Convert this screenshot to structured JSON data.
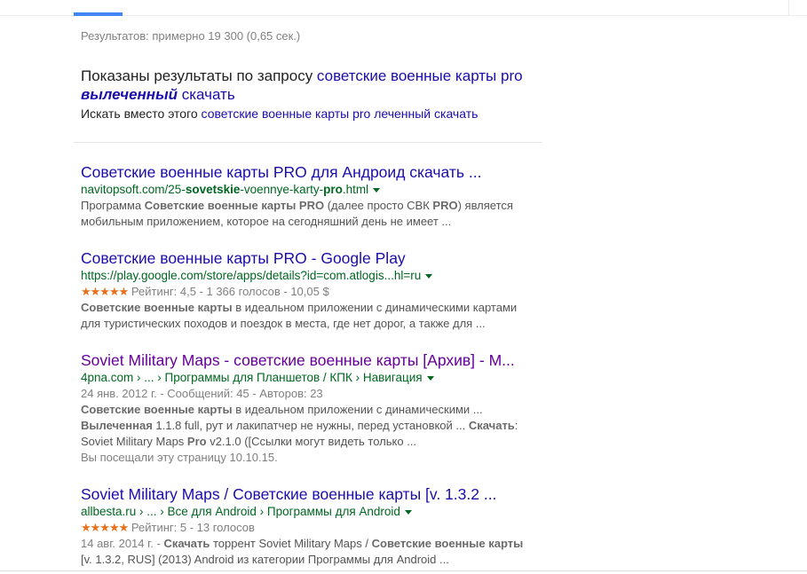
{
  "stats": "Результатов: примерно 19 300 (0,65 сек.)",
  "spelling": {
    "prefix": "Показаны результаты по запросу ",
    "corrected_part1": "советские военные карты",
    "corrected_part2": "pro",
    "corrected_word": "вылеченный",
    "corrected_part3": "скачать",
    "instead_prefix": "Искать вместо этого ",
    "instead_query": "советские военные карты pro леченный скачать"
  },
  "results": [
    {
      "title": "Советские военные карты PRO для Андроид скачать ...",
      "url_pre": "navitopsoft.com/25-",
      "url_b1": "sovetskie",
      "url_mid": "-voennye-karty-",
      "url_b2": "pro",
      "url_post": ".html",
      "snippet1_a": "Программа ",
      "snippet1_b": "Советские военные карты PRO",
      "snippet1_c": " (далее просто СВК ",
      "snippet1_d": "PRO",
      "snippet1_e": ") является",
      "snippet2": "мобильным приложением, которое на сегодняшний день не имеет ..."
    },
    {
      "title": "Советские военные карты PRO - Google Play",
      "url": "https://play.google.com/store/apps/details?id=com.atlogis...hl=ru",
      "stars": "★★★★★",
      "rating": "Рейтинг: 4,5 - 1 366 голосов - 10,05 $",
      "snippet1_b": "Советские военные карты",
      "snippet1_c": " в идеальном приложении с динамическими картами",
      "snippet2": "для туристических походов и поездок в места, где нет дорог, а также для ..."
    },
    {
      "title": "Soviet Military Maps - советские военные карты [Архив] - M...",
      "url": "4pna.com › ... › Программы для Планшетов / КПК › Навигация",
      "date": "24 янв. 2012 г. - Сообщений: 45 - Авторов: 23",
      "snippet1_b": "Советские военные карты",
      "snippet1_c": " в идеальном приложении с динамическими ...",
      "snippet2_b": "Вылеченная",
      "snippet2_c": " 1.1.8 full, рут и лакипатчер не нужны, перед установкой ... ",
      "snippet2_d": "Скачать",
      "snippet2_e": ":",
      "snippet3_a": "Soviet Military Maps ",
      "snippet3_b": "Pro",
      "snippet3_c": " v2.1.0 ([Ссылки могут видеть только ...",
      "visited_note": "Вы посещали эту страницу 10.10.15."
    },
    {
      "title": "Soviet Military Maps / Советские военные карты [v. 1.3.2 ...",
      "url": "allbesta.ru › ... › Все для Android › Программы для Android",
      "stars": "★★★★★",
      "rating": "Рейтинг: 5 - 13 голосов",
      "date": "14 авг. 2014 г. - ",
      "snippet1_b": "Скачать",
      "snippet1_c": " торрент Soviet Military Maps / ",
      "snippet1_d": "Советские военные карты",
      "snippet2": "[v. 1.3.2, RUS] (2013) Android из категории Программы для Android ..."
    }
  ],
  "colors": {
    "link": "#1a0dab",
    "visited": "#660099",
    "url": "#006621",
    "stars": "#e7711b",
    "tab_accent": "#4285f4"
  }
}
